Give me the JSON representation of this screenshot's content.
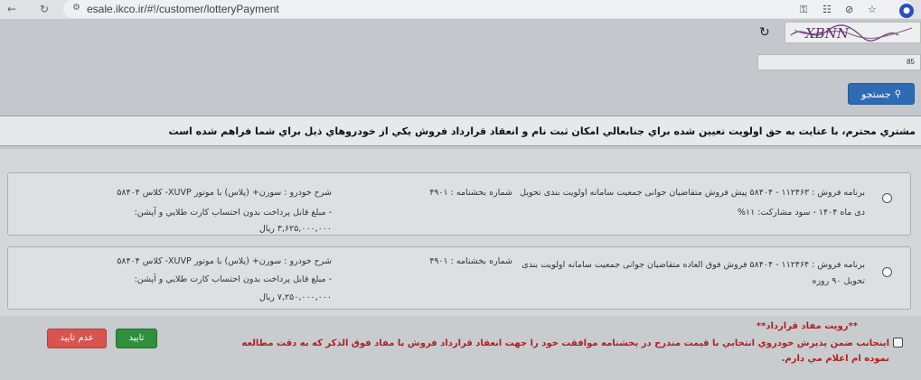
{
  "browser": {
    "back_icon": "back-arrow",
    "reload_icon": "reload",
    "url": "esale.ikco.ir/#!/customer/lotteryPayment",
    "icons": [
      "key-icon",
      "translate-icon",
      "eye-off-icon",
      "star-icon",
      "profile-icon"
    ]
  },
  "captcha": {
    "refresh_icon": "refresh",
    "image_text": "XBNN",
    "input_value": "85"
  },
  "search": {
    "label": "جستجو",
    "icon": "search",
    "color": "#2f6bb5"
  },
  "notice": "مشتري محترم، با عنايت به حق اولويت تعيين شده براي جنابعالي امكان ثبت نام و انعقاد قرارداد فروش يكي از خودروهاي ذيل براي شما فراهم شده است",
  "offers": [
    {
      "program": "برنامه فروش : ۱۱۲۴۶۳ - ۵۸۴۰۴ پیش فروش متقاضیان جوانی جمعیت سامانه اولویت بندی تحویل",
      "circular": "شماره بخشنامه : ۴۹۰۱",
      "car": "شرح خودرو : سورن+ (پلاس) با موتور XUVP- كلاس ۵۸۴۰۴",
      "delivery": "دی ماه ۱۴۰۴ - سود مشارکت: ۱۱%",
      "note": "- مبلغ قابل پرداخت بدون احتساب كارت طلايي و آپشن:",
      "amount": "۳,۶۲۵,۰۰۰,۰۰۰ ريال"
    },
    {
      "program": "برنامه فروش : ۱۱۲۴۶۴ - ۵۸۴۰۴ فروش فوق العاده متقاضيان جوانی جمعيت سامانه اولويت بندی",
      "circular": "شماره بخشنامه : ۴۹۰۱",
      "car": "شرح خودرو : سورن+ (پلاس) با موتور XUVP- كلاس ۵۸۴۰۴",
      "delivery": "تحویل ۹۰ روزه",
      "note": "- مبلغ قابل پرداخت بدون احتساب كارت طلايي و آپشن:",
      "amount": "۷,۲۵۰,۰۰۰,۰۰۰ ريال"
    }
  ],
  "contract": {
    "title": "**رويت مفاد قرارداد**",
    "agree_text": "اينجانب ضمن پذيرش خودروي انتخابي با قيمت مندرج در بخشنامه موافقت خود را جهت انعقاد قرارداد فروش با مفاد فوق الذكر كه به دقت مطالعه نموده ام اعلام مي دارم.",
    "confirm_label": "تاييد",
    "reject_label": "عدم تاييد",
    "confirm_color": "#2f8f3c",
    "reject_color": "#d9534f"
  }
}
